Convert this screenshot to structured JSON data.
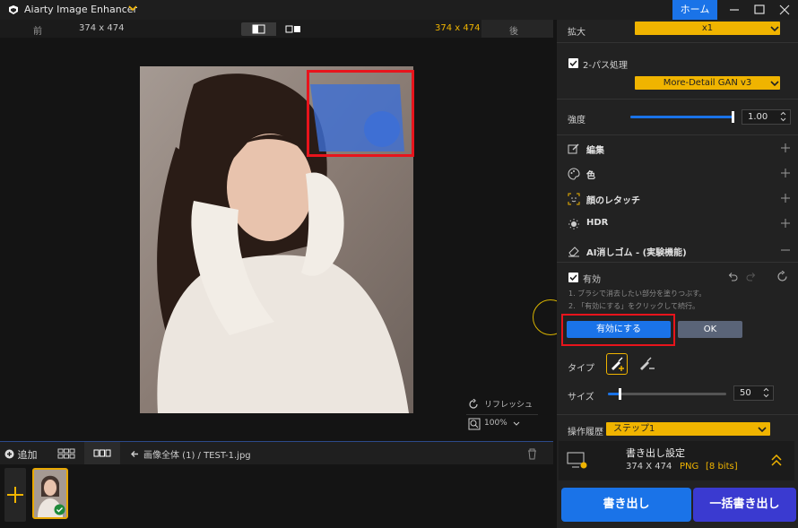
{
  "titlebar": {
    "app_title": "Aiarty Image Enhancer",
    "home_label": "ホーム"
  },
  "preview": {
    "before_label": "前",
    "after_label": "後",
    "size_before": "374 x 474",
    "size_after": "374 x 474",
    "refresh_label": "リフレッシュ",
    "zoom_level": "100%"
  },
  "bottom": {
    "add_label": "追加",
    "breadcrumb": "画像全体 (1)  /  TEST-1.jpg"
  },
  "panel": {
    "scale_label": "拡大",
    "scale_value": "x1",
    "two_pass_label": "2-パス処理",
    "model_value": "More-Detail GAN  v3",
    "strength_label": "強度",
    "strength_value": "1.00",
    "strength_fraction": 1.0,
    "sections": [
      {
        "label": "編集",
        "icon": "edit-icon"
      },
      {
        "label": "色",
        "icon": "palette-icon"
      },
      {
        "label": "顔のレタッチ",
        "icon": "face-icon"
      },
      {
        "label": "HDR",
        "icon": "hdr-icon"
      },
      {
        "label": "AI消しゴム - (実験機能)",
        "icon": "eraser-icon"
      }
    ],
    "enable_label": "有効",
    "hint_1": "1. ブラシで消去したい部分を塗りつぶす。",
    "hint_2": "2. 「有効にする」をクリックして続行。",
    "apply_button": "有効にする",
    "ok_button": "OK",
    "type_label": "タイプ",
    "size_label": "サイズ",
    "size_value": "50",
    "size_fraction": 0.1,
    "history_label": "操作履歴",
    "history_value": "ステップ1",
    "export_settings_title": "書き出し設定",
    "export_dims": "374 X 474",
    "export_format": "PNG",
    "export_bits": "[8 bits]",
    "export_button": "書き出し",
    "batch_export_button": "一括書き出し"
  },
  "colors": {
    "accent": "#1a73e8",
    "highlight": "#f0b400",
    "annotation": "#e8141c"
  }
}
